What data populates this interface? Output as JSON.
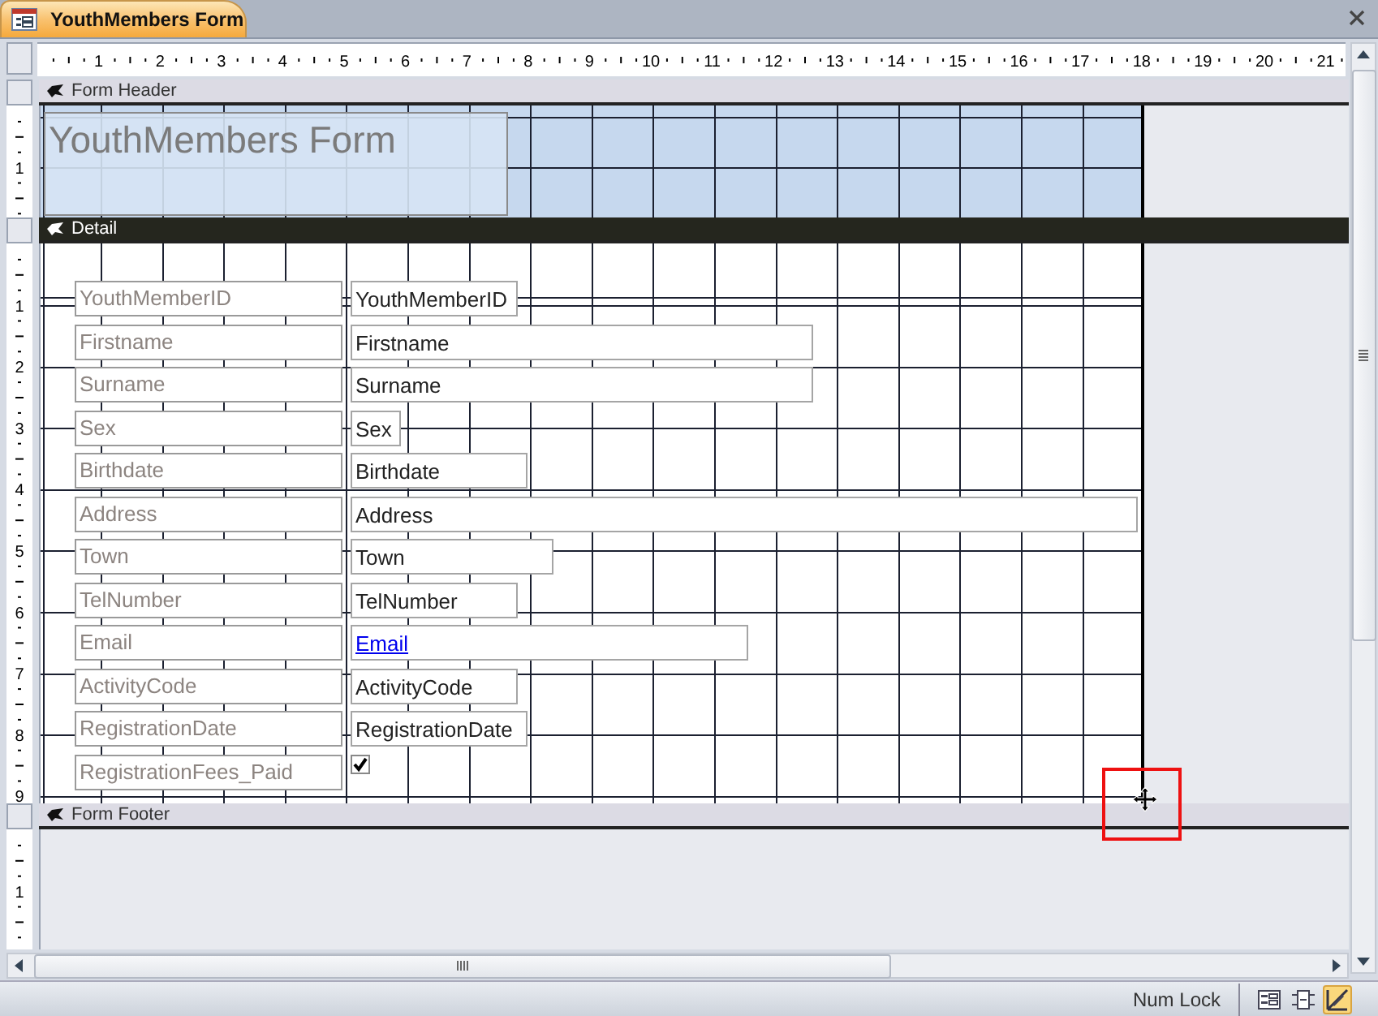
{
  "document_tab": {
    "title": "YouthMembers Form"
  },
  "horizontal_ruler": [
    "1",
    "2",
    "3",
    "4",
    "5",
    "6",
    "7",
    "8",
    "9",
    "10",
    "11",
    "12",
    "13",
    "14",
    "15",
    "16",
    "17",
    "18",
    "19",
    "20",
    "21"
  ],
  "sections": [
    {
      "kind": "header",
      "title": "Form Header",
      "selected": false,
      "ruler": [
        "1"
      ],
      "title_label": "YouthMembers Form"
    },
    {
      "kind": "detail",
      "title": "Detail",
      "selected": true,
      "ruler": [
        "1",
        "2",
        "3",
        "4",
        "5",
        "6",
        "7",
        "8",
        "9"
      ],
      "fields": [
        {
          "label": "YouthMemberID",
          "kind": "text",
          "value": "YouthMemberID"
        },
        {
          "label": "Firstname",
          "kind": "text",
          "value": "Firstname"
        },
        {
          "label": "Surname",
          "kind": "text",
          "value": "Surname"
        },
        {
          "label": "Sex",
          "kind": "text",
          "value": "Sex"
        },
        {
          "label": "Birthdate",
          "kind": "text",
          "value": "Birthdate"
        },
        {
          "label": "Address",
          "kind": "text",
          "value": "Address"
        },
        {
          "label": "Town",
          "kind": "text",
          "value": "Town"
        },
        {
          "label": "TelNumber",
          "kind": "text",
          "value": "TelNumber"
        },
        {
          "label": "Email",
          "kind": "link",
          "value": "Email"
        },
        {
          "label": "ActivityCode",
          "kind": "text",
          "value": "ActivityCode"
        },
        {
          "label": "RegistrationDate",
          "kind": "text",
          "value": "RegistrationDate"
        },
        {
          "label": "RegistrationFees_Paid",
          "kind": "checkbox",
          "checked": true
        }
      ]
    },
    {
      "kind": "footer",
      "title": "Form Footer",
      "selected": false,
      "ruler": [
        "1"
      ]
    }
  ],
  "status_bar": {
    "text": "Num Lock",
    "views": [
      {
        "kind": "form",
        "selected": false
      },
      {
        "kind": "layout",
        "selected": false
      },
      {
        "kind": "design",
        "selected": true
      }
    ]
  }
}
